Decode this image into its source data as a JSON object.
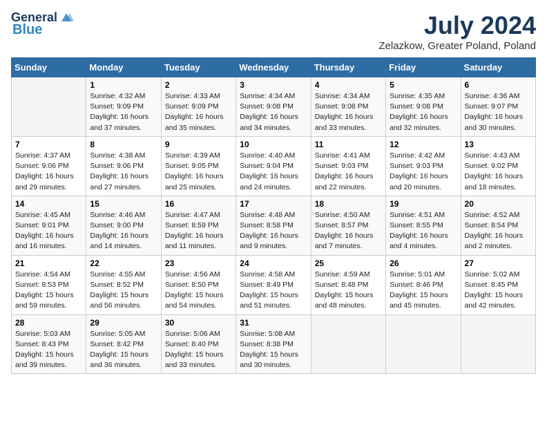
{
  "header": {
    "logo_line1": "General",
    "logo_line2": "Blue",
    "month": "July 2024",
    "location": "Zelazkow, Greater Poland, Poland"
  },
  "weekdays": [
    "Sunday",
    "Monday",
    "Tuesday",
    "Wednesday",
    "Thursday",
    "Friday",
    "Saturday"
  ],
  "weeks": [
    [
      {
        "day": "",
        "info": ""
      },
      {
        "day": "1",
        "info": "Sunrise: 4:32 AM\nSunset: 9:09 PM\nDaylight: 16 hours\nand 37 minutes."
      },
      {
        "day": "2",
        "info": "Sunrise: 4:33 AM\nSunset: 9:09 PM\nDaylight: 16 hours\nand 35 minutes."
      },
      {
        "day": "3",
        "info": "Sunrise: 4:34 AM\nSunset: 9:08 PM\nDaylight: 16 hours\nand 34 minutes."
      },
      {
        "day": "4",
        "info": "Sunrise: 4:34 AM\nSunset: 9:08 PM\nDaylight: 16 hours\nand 33 minutes."
      },
      {
        "day": "5",
        "info": "Sunrise: 4:35 AM\nSunset: 9:08 PM\nDaylight: 16 hours\nand 32 minutes."
      },
      {
        "day": "6",
        "info": "Sunrise: 4:36 AM\nSunset: 9:07 PM\nDaylight: 16 hours\nand 30 minutes."
      }
    ],
    [
      {
        "day": "7",
        "info": "Sunrise: 4:37 AM\nSunset: 9:06 PM\nDaylight: 16 hours\nand 29 minutes."
      },
      {
        "day": "8",
        "info": "Sunrise: 4:38 AM\nSunset: 9:06 PM\nDaylight: 16 hours\nand 27 minutes."
      },
      {
        "day": "9",
        "info": "Sunrise: 4:39 AM\nSunset: 9:05 PM\nDaylight: 16 hours\nand 25 minutes."
      },
      {
        "day": "10",
        "info": "Sunrise: 4:40 AM\nSunset: 9:04 PM\nDaylight: 16 hours\nand 24 minutes."
      },
      {
        "day": "11",
        "info": "Sunrise: 4:41 AM\nSunset: 9:03 PM\nDaylight: 16 hours\nand 22 minutes."
      },
      {
        "day": "12",
        "info": "Sunrise: 4:42 AM\nSunset: 9:03 PM\nDaylight: 16 hours\nand 20 minutes."
      },
      {
        "day": "13",
        "info": "Sunrise: 4:43 AM\nSunset: 9:02 PM\nDaylight: 16 hours\nand 18 minutes."
      }
    ],
    [
      {
        "day": "14",
        "info": "Sunrise: 4:45 AM\nSunset: 9:01 PM\nDaylight: 16 hours\nand 16 minutes."
      },
      {
        "day": "15",
        "info": "Sunrise: 4:46 AM\nSunset: 9:00 PM\nDaylight: 16 hours\nand 14 minutes."
      },
      {
        "day": "16",
        "info": "Sunrise: 4:47 AM\nSunset: 8:59 PM\nDaylight: 16 hours\nand 11 minutes."
      },
      {
        "day": "17",
        "info": "Sunrise: 4:48 AM\nSunset: 8:58 PM\nDaylight: 16 hours\nand 9 minutes."
      },
      {
        "day": "18",
        "info": "Sunrise: 4:50 AM\nSunset: 8:57 PM\nDaylight: 16 hours\nand 7 minutes."
      },
      {
        "day": "19",
        "info": "Sunrise: 4:51 AM\nSunset: 8:55 PM\nDaylight: 16 hours\nand 4 minutes."
      },
      {
        "day": "20",
        "info": "Sunrise: 4:52 AM\nSunset: 8:54 PM\nDaylight: 16 hours\nand 2 minutes."
      }
    ],
    [
      {
        "day": "21",
        "info": "Sunrise: 4:54 AM\nSunset: 8:53 PM\nDaylight: 15 hours\nand 59 minutes."
      },
      {
        "day": "22",
        "info": "Sunrise: 4:55 AM\nSunset: 8:52 PM\nDaylight: 15 hours\nand 56 minutes."
      },
      {
        "day": "23",
        "info": "Sunrise: 4:56 AM\nSunset: 8:50 PM\nDaylight: 15 hours\nand 54 minutes."
      },
      {
        "day": "24",
        "info": "Sunrise: 4:58 AM\nSunset: 8:49 PM\nDaylight: 15 hours\nand 51 minutes."
      },
      {
        "day": "25",
        "info": "Sunrise: 4:59 AM\nSunset: 8:48 PM\nDaylight: 15 hours\nand 48 minutes."
      },
      {
        "day": "26",
        "info": "Sunrise: 5:01 AM\nSunset: 8:46 PM\nDaylight: 15 hours\nand 45 minutes."
      },
      {
        "day": "27",
        "info": "Sunrise: 5:02 AM\nSunset: 8:45 PM\nDaylight: 15 hours\nand 42 minutes."
      }
    ],
    [
      {
        "day": "28",
        "info": "Sunrise: 5:03 AM\nSunset: 8:43 PM\nDaylight: 15 hours\nand 39 minutes."
      },
      {
        "day": "29",
        "info": "Sunrise: 5:05 AM\nSunset: 8:42 PM\nDaylight: 15 hours\nand 36 minutes."
      },
      {
        "day": "30",
        "info": "Sunrise: 5:06 AM\nSunset: 8:40 PM\nDaylight: 15 hours\nand 33 minutes."
      },
      {
        "day": "31",
        "info": "Sunrise: 5:08 AM\nSunset: 8:38 PM\nDaylight: 15 hours\nand 30 minutes."
      },
      {
        "day": "",
        "info": ""
      },
      {
        "day": "",
        "info": ""
      },
      {
        "day": "",
        "info": ""
      }
    ]
  ]
}
